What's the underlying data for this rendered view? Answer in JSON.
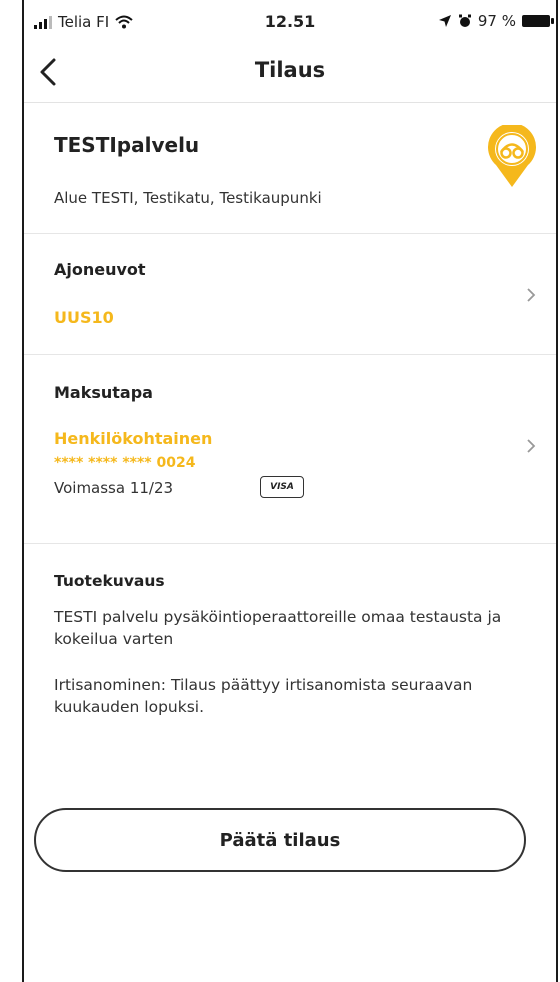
{
  "status": {
    "carrier": "Telia FI",
    "time": "12.51",
    "battery": "97 %"
  },
  "nav": {
    "title": "Tilaus"
  },
  "service": {
    "name": "TESTIpalvelu",
    "area": "Alue TESTI, Testikatu, Testikaupunki"
  },
  "vehicles": {
    "title": "Ajoneuvot",
    "plate": "UUS10"
  },
  "payment": {
    "title": "Maksutapa",
    "type": "Henkilökohtainen",
    "card": "**** **** **** 0024",
    "valid": "Voimassa 11/23",
    "brand": "VISA"
  },
  "description": {
    "title": "Tuotekuvaus",
    "text": "TESTI palvelu pysäköintioperaattoreille omaa testausta ja kokeilua varten",
    "termination": "Irtisanominen: Tilaus päättyy irtisanomista seuraavan kuukauden lopuksi."
  },
  "actions": {
    "end_subscription": "Päätä tilaus"
  },
  "colors": {
    "accent": "#f5b81c"
  }
}
